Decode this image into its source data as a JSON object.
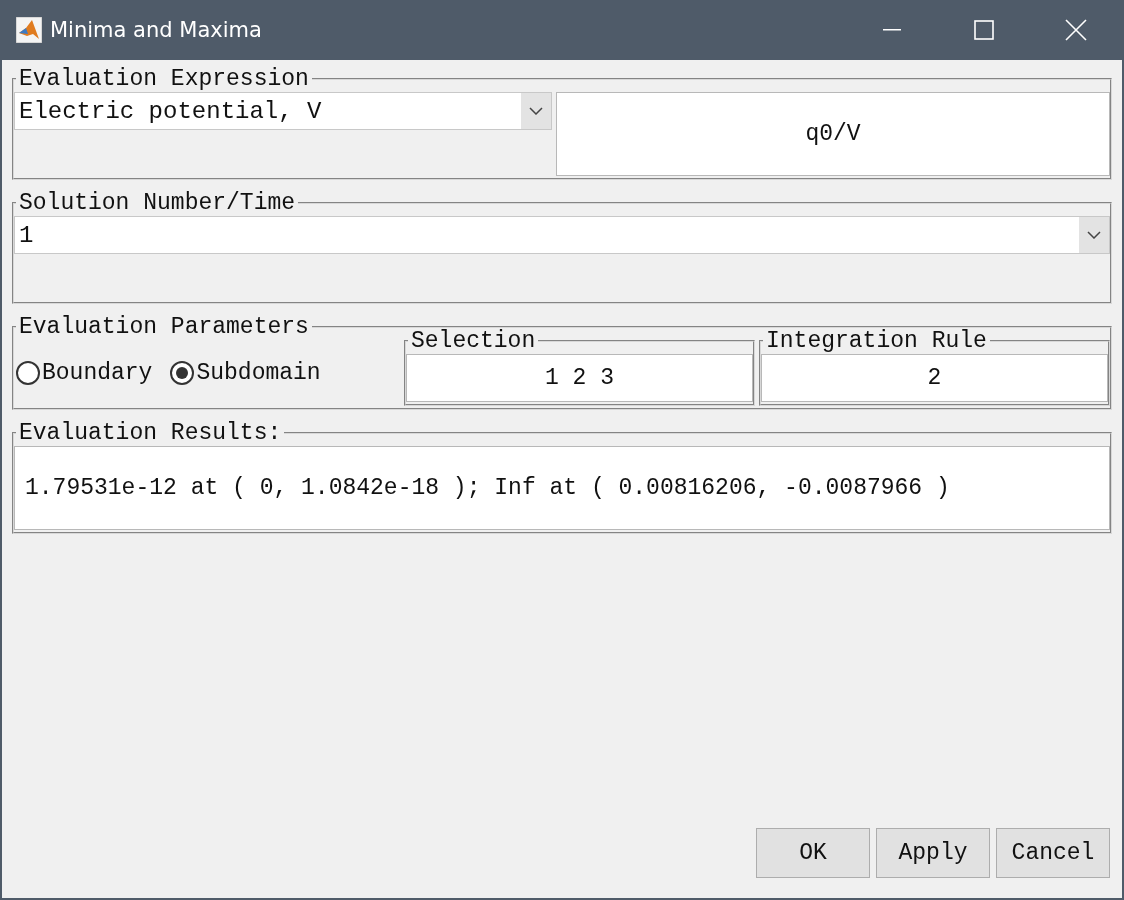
{
  "window": {
    "title": "Minima and Maxima"
  },
  "evaluation_expression": {
    "legend": "Evaluation Expression",
    "dropdown_value": "Electric potential, V",
    "expression": "q0/V"
  },
  "solution": {
    "legend": "Solution Number/Time",
    "dropdown_value": "1"
  },
  "parameters": {
    "legend": "Evaluation Parameters",
    "domains": [
      {
        "label": "Boundary",
        "selected": false
      },
      {
        "label": "Subdomain",
        "selected": true
      }
    ],
    "selection": {
      "legend": "Selection",
      "value": "1 2 3"
    },
    "integration_rule": {
      "legend": "Integration Rule",
      "value": "2"
    }
  },
  "results": {
    "legend": "Evaluation Results:",
    "text": "1.79531e-12 at ( 0, 1.0842e-18 ); Inf at ( 0.00816206, -0.0087966 )"
  },
  "buttons": [
    "OK",
    "Apply",
    "Cancel"
  ]
}
